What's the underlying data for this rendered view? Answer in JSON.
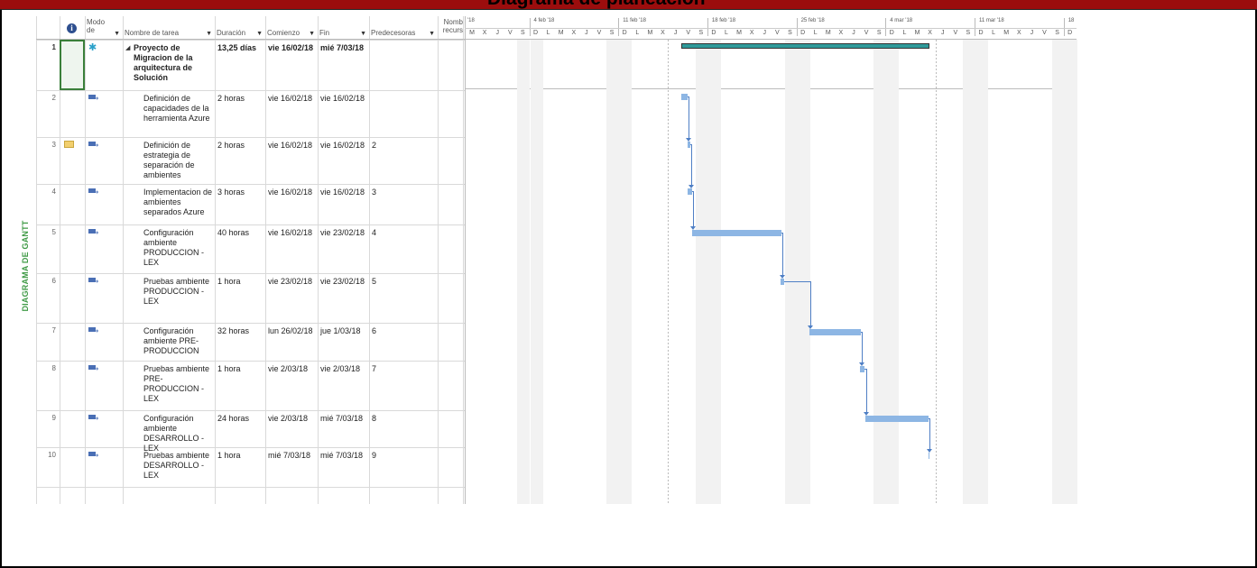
{
  "window": {
    "title": "Diagrama de planeación"
  },
  "view": {
    "side_label": "DIAGRAMA DE GANTT"
  },
  "columns": {
    "info_icon": "info-icon",
    "mode": "Modo de",
    "task_name": "Nombre de tarea",
    "duration": "Duración",
    "start": "Comienzo",
    "finish": "Fin",
    "predecessors": "Predecesoras",
    "resources": "Nomb recurs"
  },
  "timeline": {
    "top_labels": [
      "'18",
      "4 feb '18",
      "11 feb '18",
      "18 feb '18",
      "25 feb '18",
      "4 mar '18",
      "11 mar '18",
      "18"
    ],
    "day_letters": [
      "M",
      "X",
      "J",
      "V",
      "S",
      "D",
      "L",
      "M",
      "X",
      "J",
      "V",
      "S",
      "D",
      "L",
      "M",
      "X",
      "J",
      "V",
      "S",
      "D",
      "L",
      "M",
      "X",
      "J",
      "V",
      "S",
      "D",
      "L",
      "M",
      "X",
      "J",
      "V",
      "S",
      "D",
      "L",
      "M",
      "X",
      "J",
      "V",
      "S",
      "D",
      "L",
      "M",
      "X",
      "J",
      "V",
      "S",
      "D"
    ]
  },
  "tasks": [
    {
      "id": "1",
      "name": "Proyecto de Migracion de la arquitectura de Solución",
      "duration": "13,25 días",
      "start": "vie 16/02/18",
      "finish": "mié 7/03/18",
      "pred": "",
      "summary": true
    },
    {
      "id": "2",
      "name": "Definición de capacidades de la herramienta Azure",
      "duration": "2 horas",
      "start": "vie 16/02/18",
      "finish": "vie 16/02/18",
      "pred": ""
    },
    {
      "id": "3",
      "name": "Definición de estrategia de separación de ambientes",
      "duration": "2 horas",
      "start": "vie 16/02/18",
      "finish": "vie 16/02/18",
      "pred": "2",
      "note": true
    },
    {
      "id": "4",
      "name": "Implementacion de ambientes separados Azure",
      "duration": "3 horas",
      "start": "vie 16/02/18",
      "finish": "vie 16/02/18",
      "pred": "3"
    },
    {
      "id": "5",
      "name": "Configuración ambiente PRODUCCION - LEX",
      "duration": "40 horas",
      "start": "vie 16/02/18",
      "finish": "vie 23/02/18",
      "pred": "4"
    },
    {
      "id": "6",
      "name": "Pruebas ambiente PRODUCCION - LEX",
      "duration": "1 hora",
      "start": "vie 23/02/18",
      "finish": "vie 23/02/18",
      "pred": "5"
    },
    {
      "id": "7",
      "name": "Configuración ambiente PRE-PRODUCCION",
      "duration": "32 horas",
      "start": "lun 26/02/18",
      "finish": "jue 1/03/18",
      "pred": "6"
    },
    {
      "id": "8",
      "name": "Pruebas ambiente PRE-PRODUCCION - LEX",
      "duration": "1 hora",
      "start": "vie 2/03/18",
      "finish": "vie 2/03/18",
      "pred": "7"
    },
    {
      "id": "9",
      "name": "Configuración ambiente DESARROLLO - LEX",
      "duration": "24 horas",
      "start": "vie 2/03/18",
      "finish": "mié 7/03/18",
      "pred": "8"
    },
    {
      "id": "10",
      "name": "Pruebas ambiente DESARROLLO - LEX",
      "duration": "1 hora",
      "start": "mié 7/03/18",
      "finish": "mié 7/03/18",
      "pred": "9"
    }
  ],
  "colors": {
    "title_bar": "#9b0d0d",
    "bar": "#8db6e4",
    "summary_bar": "#2e9a9a",
    "link": "#4f7fc5",
    "side_label": "#3f9a46"
  }
}
